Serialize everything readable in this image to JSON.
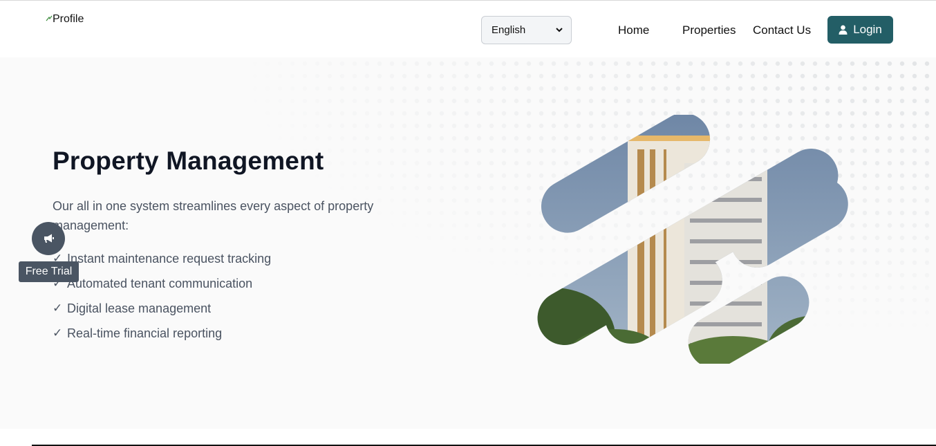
{
  "header": {
    "logo_text": "Profile",
    "language": {
      "selected": "English"
    },
    "nav": [
      {
        "label": "Home"
      },
      {
        "label": "Properties"
      },
      {
        "label": "Contact Us"
      }
    ],
    "login_label": "Login"
  },
  "hero": {
    "title": "Property Management",
    "intro": "Our all in one system streamlines every aspect of property management:",
    "features": [
      {
        "check": "✓",
        "text": "Instant maintenance request tracking"
      },
      {
        "check": "✓",
        "text": "Automated tenant communication"
      },
      {
        "check": "✓",
        "text": "Digital lease management"
      },
      {
        "check": "✓",
        "text": "Real-time financial reporting"
      }
    ]
  },
  "floating": {
    "trial_label": "Free Trial",
    "icon": "megaphone-icon"
  },
  "colors": {
    "accent": "#235e66",
    "floating_bg": "#4a5563",
    "text_dark": "#101624",
    "text_muted": "#4a5361"
  }
}
